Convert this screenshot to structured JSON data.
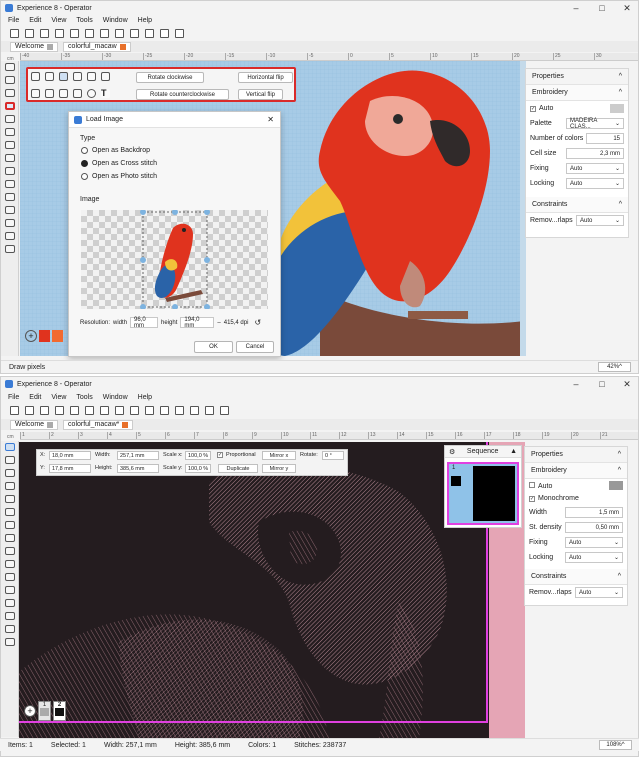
{
  "w1": {
    "title": "Experience 8 - Operator",
    "menu": [
      "File",
      "Edit",
      "View",
      "Tools",
      "Window",
      "Help"
    ],
    "tabs": [
      "Welcome",
      "colorful_macaw"
    ],
    "rotate_cw": "Rotate clockwise",
    "rotate_ccw": "Rotate counterclockwise",
    "hflip": "Horizontal flip",
    "vflip": "Vertical flip",
    "status": "Draw pixels",
    "zoom": "42%",
    "ruler": [
      "-40",
      "-35",
      "-30",
      "-25",
      "-20",
      "-15",
      "-10",
      "-5",
      "0",
      "5",
      "10",
      "15",
      "20",
      "25",
      "30"
    ],
    "properties": {
      "title": "Properties",
      "section": "Embroidery",
      "auto": "Auto",
      "palette_label": "Palette",
      "palette_value": "MADEIRA CLAS...",
      "colors_label": "Number of colors",
      "colors_value": "15",
      "cell_label": "Cell size",
      "cell_value": "2,3 mm",
      "fixing_label": "Fixing",
      "fixing_value": "Auto",
      "locking_label": "Locking",
      "locking_value": "Auto",
      "constraints": "Constraints",
      "remove_label": "Remov...rlaps",
      "remove_value": "Auto"
    },
    "dialog": {
      "title": "Load Image",
      "type_label": "Type",
      "opt_backdrop": "Open as Backdrop",
      "opt_cross": "Open as Cross stitch",
      "opt_photo": "Open as Photo stitch",
      "image_label": "Image",
      "resolution": "Resolution:",
      "width_label": "width",
      "width_value": "96,0 mm",
      "height_label": "height",
      "height_value": "194,0 mm",
      "dpi": "415,4 dpi",
      "ok": "OK",
      "cancel": "Cancel"
    }
  },
  "w2": {
    "title": "Experience 8 - Operator",
    "menu": [
      "File",
      "Edit",
      "View",
      "Tools",
      "Window",
      "Help"
    ],
    "tabs": [
      "Welcome",
      "colorful_macaw*"
    ],
    "x_label": "X:",
    "x_value": "18,0 mm",
    "y_label": "Y:",
    "y_value": "17,8 mm",
    "width_label": "Width:",
    "width_value": "257,1 mm",
    "height_label": "Height:",
    "height_value": "385,6 mm",
    "scalex_label": "Scale x:",
    "scalex_value": "100,0 %",
    "scaley_label": "Scale y:",
    "scaley_value": "100,0 %",
    "proportional": "Proportional",
    "duplicate": "Duplicate",
    "mirror_x": "Mirror x",
    "mirror_y": "Mirror y",
    "rotate_label": "Rotate:",
    "rotate_value": "0 °",
    "sequence": "Sequence",
    "seq_number": "1",
    "palette_nums": [
      "1",
      "2"
    ],
    "status": {
      "items": "Items: 1",
      "selected": "Selected: 1",
      "width": "Width: 257,1 mm",
      "height": "Height: 385,6 mm",
      "colors": "Colors: 1",
      "stitches": "Stitches: 238737"
    },
    "zoom": "108%",
    "ruler": [
      "1",
      "2",
      "3",
      "4",
      "5",
      "6",
      "7",
      "8",
      "9",
      "10",
      "11",
      "12",
      "13",
      "14",
      "15",
      "16",
      "17",
      "18",
      "19",
      "20",
      "21"
    ],
    "properties": {
      "title": "Properties",
      "section": "Embroidery",
      "auto": "Auto",
      "mono": "Monochrome",
      "width_label": "Width",
      "width_value": "1,5 mm",
      "density_label": "St. density",
      "density_value": "0,50 mm",
      "fixing_label": "Fixing",
      "fixing_value": "Auto",
      "locking_label": "Locking",
      "locking_value": "Auto",
      "constraints": "Constraints",
      "remove_label": "Remov...rlaps",
      "remove_value": "Auto"
    }
  },
  "colors": {
    "accent_red": "#d92a2a",
    "canvas_blue": "#a7cbe6",
    "selection_magenta": "#e040e0",
    "stitch_pink": "#d9a3b0",
    "dark_bg": "#241c1f"
  }
}
